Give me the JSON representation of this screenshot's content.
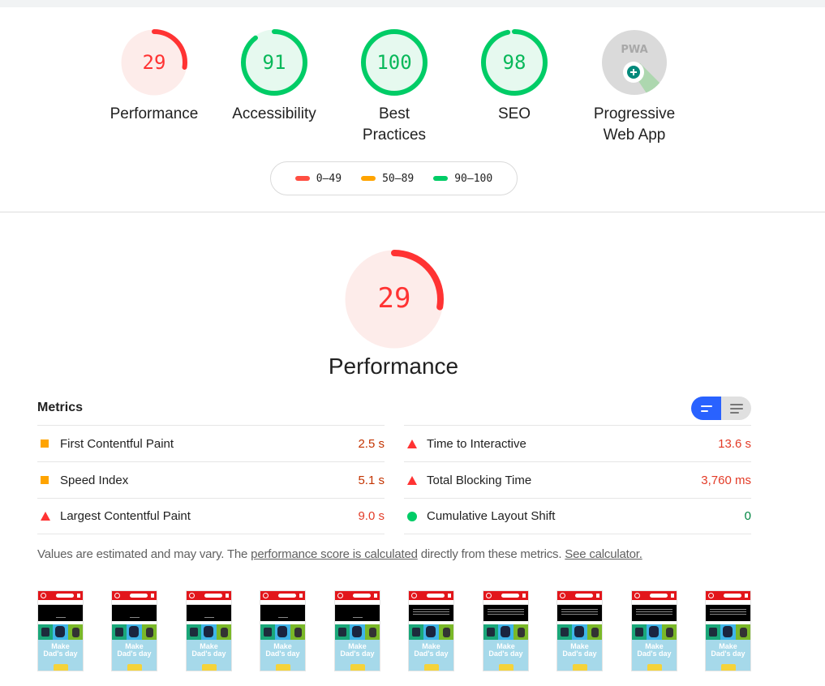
{
  "colors": {
    "fail": "#ff3333",
    "fail_bg": "#fdecea",
    "average": "#ffa400",
    "pass": "#00cc66",
    "pass_bg": "#e6f9ef",
    "toggle_active": "#2962ff",
    "metric_value_fail": "#e33b27",
    "metric_value_pass": "#018642"
  },
  "categories": [
    {
      "name": "performance",
      "label": "Performance",
      "score": 29,
      "rating": "fail"
    },
    {
      "name": "accessibility",
      "label": "Accessibility",
      "score": 91,
      "rating": "pass"
    },
    {
      "name": "best-practices",
      "label": "Best Practices",
      "score": 100,
      "rating": "pass"
    },
    {
      "name": "seo",
      "label": "SEO",
      "score": 98,
      "rating": "pass"
    },
    {
      "name": "pwa",
      "label_line1": "Progressive",
      "label_line2": "Web App",
      "badge_text": "PWA",
      "icon": "pwa-badge-icon"
    }
  ],
  "legend": [
    {
      "label": "0–49",
      "rating": "fail"
    },
    {
      "label": "50–89",
      "rating": "average"
    },
    {
      "label": "90–100",
      "rating": "pass"
    }
  ],
  "performance": {
    "score": 29,
    "title": "Performance",
    "metrics_title": "Metrics",
    "view_toggle": {
      "active": "summary",
      "options": [
        "summary-view-icon",
        "detailed-view-icon"
      ]
    },
    "metrics_left": [
      {
        "name": "First Contentful Paint",
        "value": "2.5 s",
        "rating": "average",
        "icon": "square-icon"
      },
      {
        "name": "Speed Index",
        "value": "5.1 s",
        "rating": "average",
        "icon": "square-icon"
      },
      {
        "name": "Largest Contentful Paint",
        "value": "9.0 s",
        "rating": "fail",
        "icon": "triangle-icon"
      }
    ],
    "metrics_right": [
      {
        "name": "Time to Interactive",
        "value": "13.6 s",
        "rating": "fail",
        "icon": "triangle-icon"
      },
      {
        "name": "Total Blocking Time",
        "value": "3,760 ms",
        "rating": "fail",
        "icon": "triangle-icon"
      },
      {
        "name": "Cumulative Layout Shift",
        "value": "0",
        "rating": "pass",
        "icon": "circle-icon"
      }
    ],
    "note": {
      "prefix": "Values are estimated and may vary. The ",
      "link1": "performance score is calculated",
      "middle": " directly from these metrics. ",
      "link2": "See calculator."
    },
    "filmstrip": {
      "frame_count": 10,
      "frames": [
        {
          "state": "early",
          "promo_line1": "Make",
          "promo_line2": "Dad's day"
        },
        {
          "state": "early",
          "promo_line1": "Make",
          "promo_line2": "Dad's day"
        },
        {
          "state": "early",
          "promo_line1": "Make",
          "promo_line2": "Dad's day"
        },
        {
          "state": "early",
          "promo_line1": "Make",
          "promo_line2": "Dad's day"
        },
        {
          "state": "early",
          "promo_line1": "Make",
          "promo_line2": "Dad's day"
        },
        {
          "state": "loaded",
          "promo_line1": "Make",
          "promo_line2": "Dad's day"
        },
        {
          "state": "loaded",
          "promo_line1": "Make",
          "promo_line2": "Dad's day"
        },
        {
          "state": "loaded",
          "promo_line1": "Make",
          "promo_line2": "Dad's day"
        },
        {
          "state": "loaded",
          "promo_line1": "Make",
          "promo_line2": "Dad's day"
        },
        {
          "state": "loaded",
          "promo_line1": "Make",
          "promo_line2": "Dad's day"
        }
      ]
    }
  }
}
